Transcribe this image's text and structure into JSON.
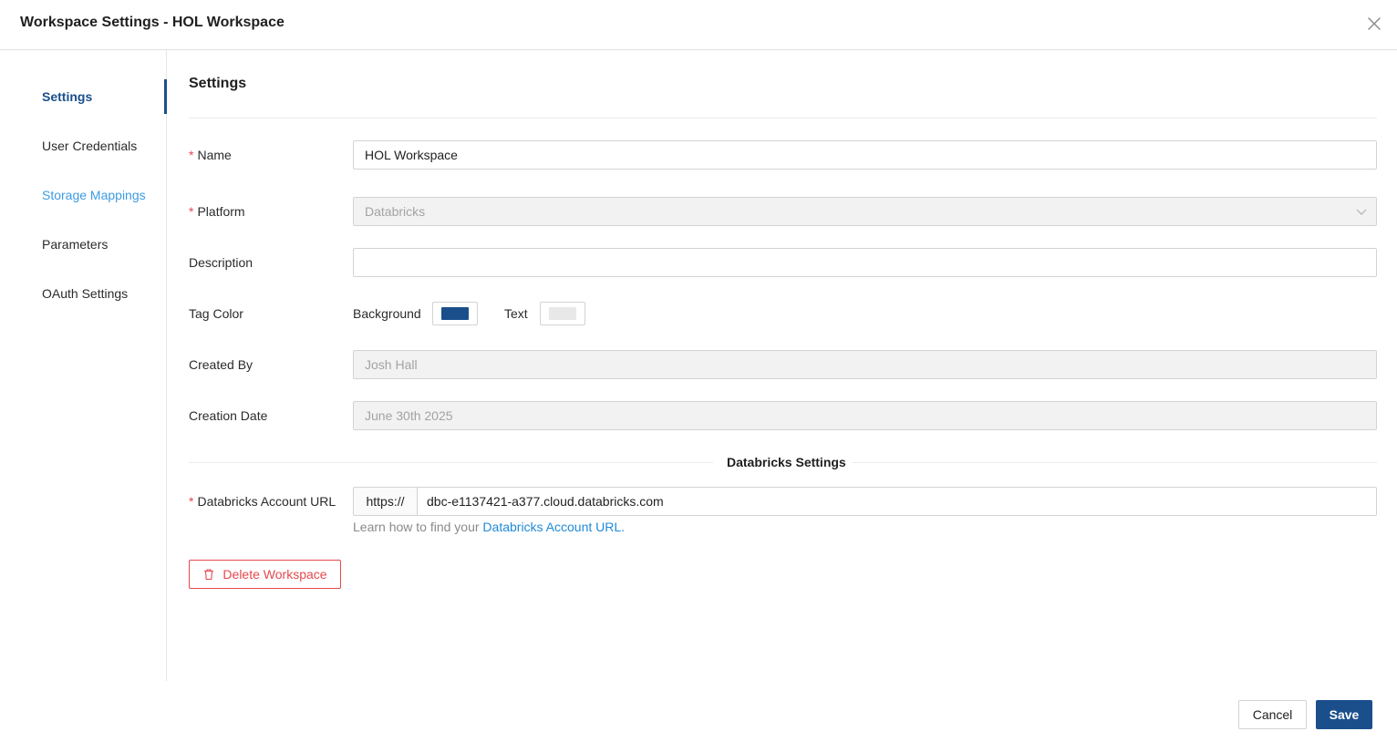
{
  "header": {
    "title": "Workspace Settings - HOL Workspace"
  },
  "sidebar": {
    "items": [
      {
        "label": "Settings"
      },
      {
        "label": "User Credentials"
      },
      {
        "label": "Storage Mappings"
      },
      {
        "label": "Parameters"
      },
      {
        "label": "OAuth Settings"
      }
    ]
  },
  "main": {
    "section_title": "Settings",
    "required_mark": "*",
    "name": {
      "label": "Name",
      "value": "HOL Workspace"
    },
    "platform": {
      "label": "Platform",
      "value": "Databricks"
    },
    "description": {
      "label": "Description",
      "value": ""
    },
    "tag_color": {
      "label": "Tag Color",
      "background_label": "Background",
      "background_color": "#1a4f8b",
      "text_label": "Text",
      "text_color": "#e8e8e8"
    },
    "created_by": {
      "label": "Created By",
      "value": "Josh Hall"
    },
    "creation_date": {
      "label": "Creation Date",
      "value": "June 30th 2025"
    },
    "databricks_section_title": "Databricks Settings",
    "account_url": {
      "label": "Databricks Account URL",
      "prefix": "https://",
      "value": "dbc-e1137421-a377.cloud.databricks.com",
      "help_text": "Learn how to find your ",
      "help_link": "Databricks Account URL."
    },
    "delete_label": "Delete Workspace"
  },
  "footer": {
    "cancel_label": "Cancel",
    "save_label": "Save"
  },
  "colors": {
    "primary": "#1a4f8b",
    "danger": "#e5484d",
    "link": "#1f8ad8"
  }
}
